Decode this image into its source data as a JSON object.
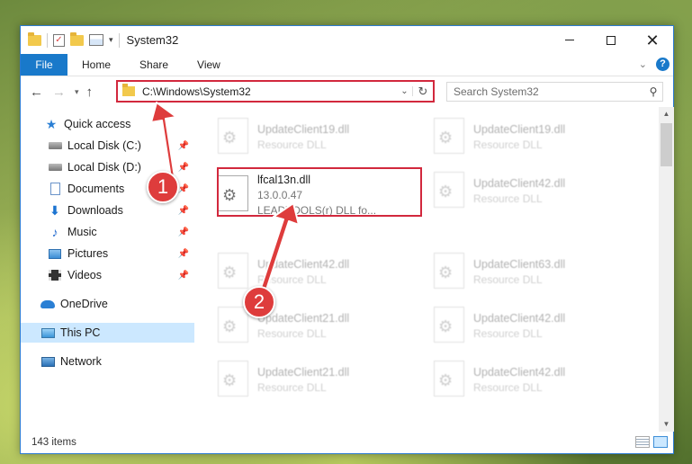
{
  "window": {
    "title": "System32",
    "controls": {
      "minimize": "minimize-icon",
      "maximize": "maximize-icon",
      "close": "close-icon"
    }
  },
  "ribbon": {
    "tabs": [
      "File",
      "Home",
      "Share",
      "View"
    ],
    "help": "?"
  },
  "nav": {
    "address": "C:\\Windows\\System32",
    "search_placeholder": "Search System32"
  },
  "sidebar": {
    "items": [
      {
        "label": "Quick access",
        "icon": "star-icon",
        "pinned": false
      },
      {
        "label": "Local Disk (C:)",
        "icon": "disk-icon",
        "pinned": true
      },
      {
        "label": "Local Disk (D:)",
        "icon": "disk-icon",
        "pinned": true
      },
      {
        "label": "Documents",
        "icon": "documents-icon",
        "pinned": true
      },
      {
        "label": "Downloads",
        "icon": "downloads-icon",
        "pinned": true
      },
      {
        "label": "Music",
        "icon": "music-icon",
        "pinned": true
      },
      {
        "label": "Pictures",
        "icon": "pictures-icon",
        "pinned": true
      },
      {
        "label": "Videos",
        "icon": "videos-icon",
        "pinned": true
      },
      {
        "label": "OneDrive",
        "icon": "onedrive-icon",
        "pinned": false
      },
      {
        "label": "This PC",
        "icon": "this-pc-icon",
        "pinned": false,
        "selected": true
      },
      {
        "label": "Network",
        "icon": "network-icon",
        "pinned": false
      }
    ]
  },
  "files": {
    "left_column": [
      {
        "name": "UpdateClient19.dll",
        "sub": "Resource DLL"
      },
      {
        "name": "lfcal13n.dll",
        "version": "13.0.0.47",
        "description": "LEADTOOLS(r) DLL fo..."
      },
      {
        "name": "UpdateClient42.dll",
        "sub": "Resource DLL"
      },
      {
        "name": "UpdateClient21.dll",
        "sub": "Resource DLL"
      },
      {
        "name": "UpdateClient21.dll",
        "sub": "Resource DLL"
      }
    ],
    "right_column": [
      {
        "name": "UpdateClient19.dll",
        "sub": "Resource DLL"
      },
      {
        "name": "UpdateClient42.dll",
        "sub": "Resource DLL"
      },
      {
        "name": "UpdateClient63.dll",
        "sub": "Resource DLL"
      },
      {
        "name": "UpdateClient42.dll",
        "sub": "Resource DLL"
      },
      {
        "name": "UpdateClient42.dll",
        "sub": "Resource DLL"
      }
    ]
  },
  "status": {
    "count": "143 items"
  },
  "annotations": {
    "step1": "1",
    "step2": "2",
    "color": "#de3c3c"
  }
}
